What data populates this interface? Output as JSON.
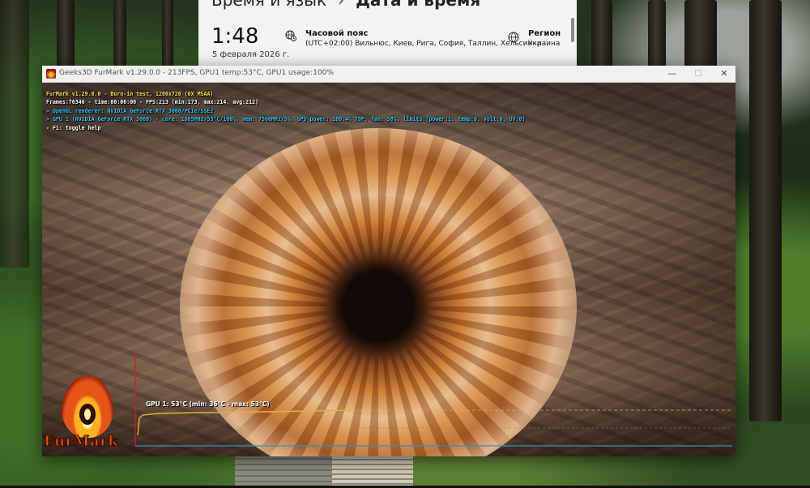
{
  "settings": {
    "breadcrumb_parent": "Время и язык",
    "breadcrumb_separator": "›",
    "breadcrumb_current": "Дата и время",
    "time": "1:48",
    "date": "5 февраля 2026 г.",
    "timezone_title": "Часовой пояс",
    "timezone_value": "(UTC+02:00) Вильнюс, Киев, Рига, София, Таллин, Хельсинки",
    "region_title": "Регион",
    "region_value": "Украина"
  },
  "furmark": {
    "window_title": "Geeks3D FurMark v1.29.0.0 - 213FPS, GPU1 temp:53°C, GPU1 usage:100%",
    "hud": [
      "FurMark v1.29.0.0 - Burn-in test, 1280x720 (0X MSAA)",
      "Frames:76346 - time:00:06:00 - FPS:213 (min:173, max:214, avg:212)",
      "> OpenGL renderer: NVIDIA GeForce RTX 3060/PCIe/SSE2",
      "> GPU 1 (NVIDIA GeForce RTX 3060) - core: 1665MHz/53°C/100%, mem: 7500MHz/5%, GPU power: 100.4% TDP, fan: 58%, limits:[power:1, temp:0, volt:0, OV:0]",
      "- F1: toggle help"
    ],
    "logo_text": "FurMark",
    "graph_label": "GPU 1: 53°C (min: 36°C - max: 53°C)",
    "temp_current": 53,
    "temp_min": 36,
    "temp_max": 53,
    "colors": {
      "hud_title": "#ffe35a",
      "hud_info": "#33c8ff",
      "graph_line": "#e0b23a",
      "graph_axis": "#3a8fb4"
    }
  },
  "window_controls": {
    "minimize": "—",
    "maximize": "☐",
    "close": "✕"
  }
}
